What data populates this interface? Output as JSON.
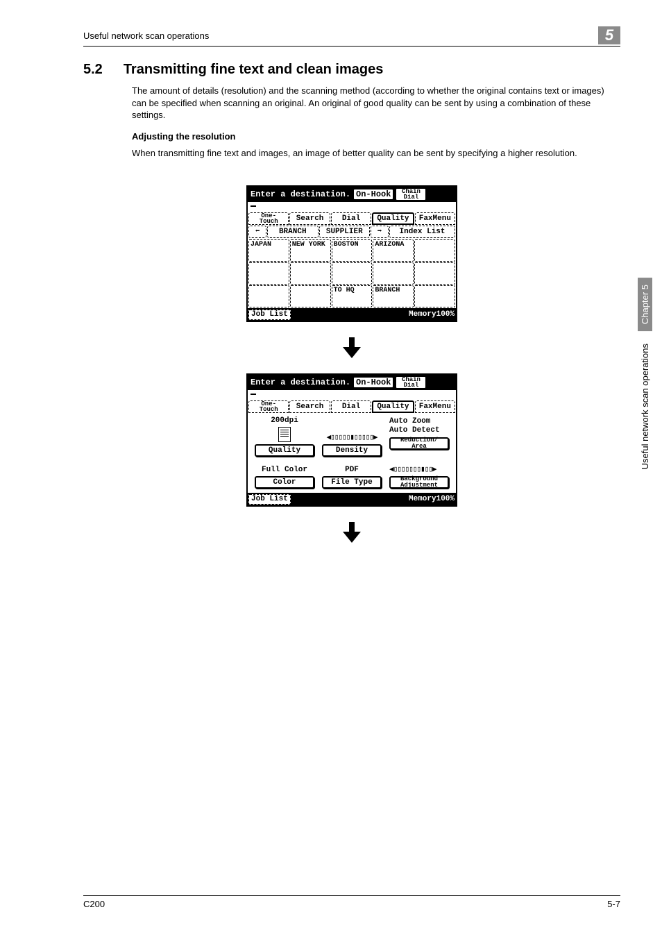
{
  "header": {
    "left": "Useful network scan operations",
    "badge": "5"
  },
  "section": {
    "num": "5.2",
    "title": "Transmitting fine text and clean images"
  },
  "para1": "The amount of details (resolution) and the scanning method (according to whether the original contains text or images) can be specified when scanning an original. An original of good quality can be sent by using a combination of these settings.",
  "sub1": "Adjusting the resolution",
  "para2": "When transmitting fine text and images, an image of better quality can be sent by specifying a higher resolution.",
  "panel1": {
    "topText": "Enter a destination.",
    "onHook": "On-Hook",
    "chain": "Chain\nDial",
    "tabs": {
      "onetouch": "One-\nTouch",
      "search": "Search",
      "dial": "Dial",
      "quality": "Quality",
      "fax": "FaxMenu"
    },
    "idx": {
      "branch": "BRANCH",
      "supplier": "SUPPLIER",
      "list": "Index List"
    },
    "cells": [
      "JAPAN",
      "NEW YORK",
      "BOSTON",
      "ARIZONA",
      "",
      "",
      "",
      "",
      "",
      "",
      "",
      "",
      "TO HQ",
      "BRANCH",
      ""
    ],
    "job": "Job List",
    "mem": "Memory100%"
  },
  "panel2": {
    "topText": "Enter a destination.",
    "onHook": "On-Hook",
    "chain": "Chain\nDial",
    "tabs": {
      "onetouch": "One-\nTouch",
      "search": "Search",
      "dial": "Dial",
      "quality": "Quality",
      "fax": "FaxMenu"
    },
    "dpi": "200dpi",
    "quality": "Quality",
    "density": "Density",
    "autoZoom": "Auto Zoom",
    "autoDetect": "Auto Detect",
    "reduction": "Reduction/\nArea",
    "fullColor": "Full Color",
    "color": "Color",
    "pdf": "PDF",
    "fileType": "File Type",
    "bg": "Background\nAdjustment",
    "job": "Job List",
    "mem": "Memory100%"
  },
  "side": {
    "chapter": "Chapter 5",
    "text": "Useful network scan operations"
  },
  "footer": {
    "left": "C200",
    "right": "5-7"
  }
}
